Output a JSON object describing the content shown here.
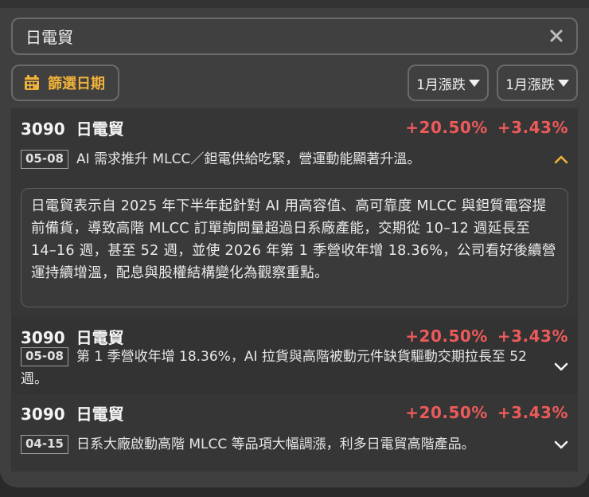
{
  "search": {
    "value": "日電貿"
  },
  "filter": {
    "label": "篩選日期"
  },
  "sort_buttons": [
    {
      "label": "1月漲跌"
    },
    {
      "label": "1月漲跌"
    }
  ],
  "colors": {
    "accent": "#f0b23a",
    "up": "#ec5a5a"
  },
  "items": [
    {
      "code": "3090",
      "name": "日電貿",
      "change1": "+20.50%",
      "change2": "+3.43%",
      "date": "05-08",
      "headline": "AI 需求推升 MLCC／鉭電供給吃緊，營運動能顯著升溫。",
      "expanded": true,
      "detail": "日電貿表示自 2025 年下半年起針對 AI 用高容值、高可靠度 MLCC 與鉭質電容提前備貨，導致高階 MLCC 訂單詢問量超過日系廠產能，交期從 10–12 週延長至 14–16 週，甚至 52 週，並使 2026 年第 1 季營收年增 18.36%，公司看好後續營運持續增溫，配息與股權結構變化為觀察重點。"
    },
    {
      "code": "3090",
      "name": "日電貿",
      "change1": "+20.50%",
      "change2": "+3.43%",
      "date": "05-08",
      "headline": "第 1 季營收年增 18.36%，AI 拉貨與高階被動元件缺貨驅動交期拉長至 52 週。",
      "expanded": false
    },
    {
      "code": "3090",
      "name": "日電貿",
      "change1": "+20.50%",
      "change2": "+3.43%",
      "date": "04-15",
      "headline": "日系大廠啟動高階 MLCC 等品項大幅調漲，利多日電貿高階產品。",
      "expanded": false
    }
  ]
}
